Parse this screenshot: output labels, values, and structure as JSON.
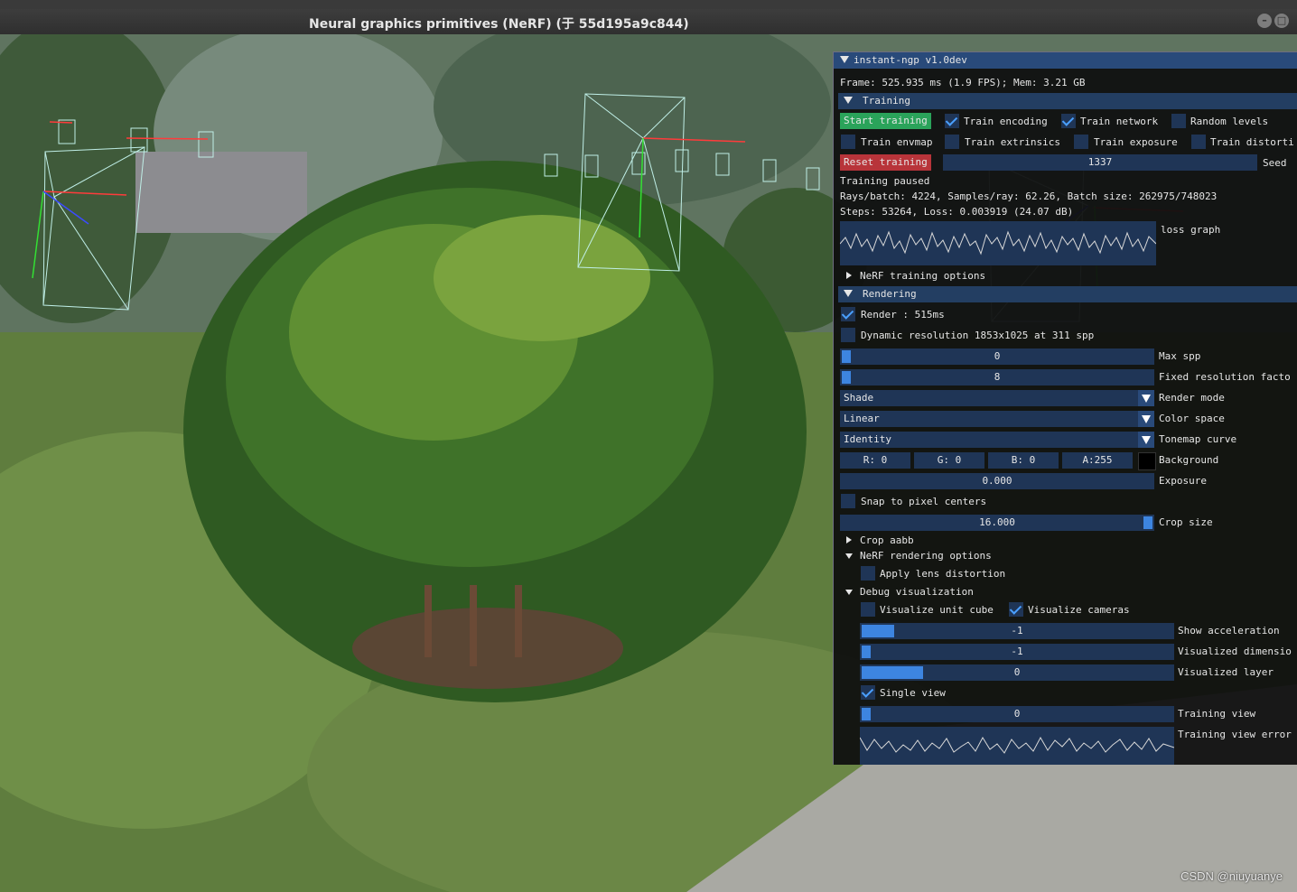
{
  "window": {
    "title": "Neural graphics primitives (NeRF) (于 55d195a9c844)"
  },
  "watermark": "CSDN @niuyuanye",
  "panel": {
    "title": "instant-ngp v1.0dev",
    "frame_info": "Frame: 525.935 ms (1.9 FPS); Mem: 3.21 GB",
    "training": {
      "header": "Training",
      "start_label": "Start training",
      "reset_label": "Reset training",
      "checkboxes": [
        {
          "label": "Train encoding",
          "checked": true
        },
        {
          "label": "Train network",
          "checked": true
        },
        {
          "label": "Random levels",
          "checked": false
        },
        {
          "label": "Train envmap",
          "checked": false
        },
        {
          "label": "Train extrinsics",
          "checked": false
        },
        {
          "label": "Train exposure",
          "checked": false
        },
        {
          "label": "Train distorti",
          "checked": false
        }
      ],
      "seed_value": "1337",
      "seed_label": "Seed",
      "status": "Training paused",
      "rays_line": "Rays/batch: 4224, Samples/ray: 62.26, Batch size: 262975/748023",
      "steps_line": "Steps: 53264, Loss: 0.003919 (24.07 dB)",
      "loss_graph_label": "loss graph",
      "options_label": "NeRF training options"
    },
    "rendering": {
      "header": "Rendering",
      "render_label": "Render : 515ms",
      "render_checked": true,
      "dynamic_label": "Dynamic resolution 1853x1025 at 311 spp",
      "max_spp": {
        "value": "0",
        "label": "Max spp"
      },
      "fixed_res": {
        "value": "8",
        "label": "Fixed resolution facto"
      },
      "render_mode": {
        "value": "Shade",
        "label": "Render mode"
      },
      "color_space": {
        "value": "Linear",
        "label": "Color space"
      },
      "tonemap": {
        "value": "Identity",
        "label": "Tonemap curve"
      },
      "background": {
        "r": "R:  0",
        "g": "G:  0",
        "b": "B:  0",
        "a": "A:255",
        "label": "Background"
      },
      "exposure": {
        "value": "0.000",
        "label": "Exposure"
      },
      "snap_label": "Snap to pixel centers",
      "crop_size": {
        "value": "16.000",
        "label": "Crop size"
      },
      "crop_aabb": "Crop aabb",
      "nerf_rendering_options": "NeRF rendering options",
      "apply_lens": "Apply lens distortion",
      "debug_vis": "Debug visualization",
      "vis_unit_cube": "Visualize unit cube",
      "vis_cameras": "Visualize cameras",
      "show_accel": {
        "value": "-1",
        "label": "Show acceleration"
      },
      "vis_dimension": {
        "value": "-1",
        "label": "Visualized dimensio"
      },
      "vis_layer": {
        "value": "0",
        "label": "Visualized layer"
      },
      "single_view": "Single view",
      "training_view": {
        "value": "0",
        "label": "Training view"
      },
      "training_view_error": "Training view error"
    }
  }
}
